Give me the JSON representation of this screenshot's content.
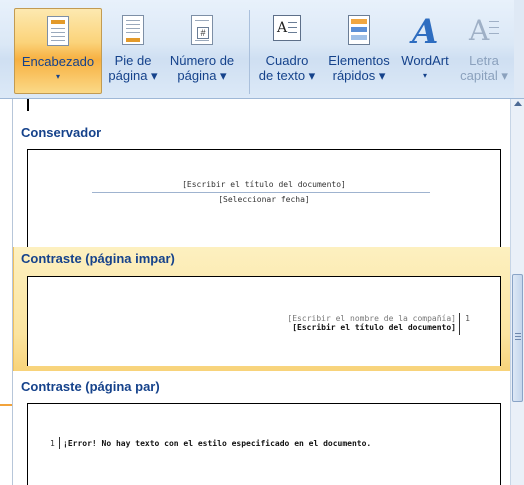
{
  "ribbon": {
    "buttons": [
      {
        "line1": "Encabezado",
        "line2": "▾"
      },
      {
        "line1": "Pie de",
        "line2": "página ▾"
      },
      {
        "line1": "Número de",
        "line2": "página ▾"
      },
      {
        "line1": "Cuadro",
        "line2": "de texto ▾"
      },
      {
        "line1": "Elementos",
        "line2": "rápidos ▾"
      },
      {
        "line1": "WordArt",
        "line2": "▾"
      },
      {
        "line1": "Letra",
        "line2": "capital ▾"
      }
    ],
    "icon_letters": {
      "textbox": "A",
      "wordart": "A",
      "dropcap": "A",
      "page_number": "#"
    }
  },
  "gallery": {
    "sections": [
      {
        "title": "Conservador",
        "preview_lines": [
          "[Escribir el título del documento]",
          "[Seleccionar fecha]"
        ]
      },
      {
        "title": "Contraste (página impar)",
        "preview_lines": [
          "[Escribir el nombre de la compañía]",
          "[Escribir el título del documento]"
        ],
        "page_number": "1"
      },
      {
        "title": "Contraste (página par)",
        "page_number": "1",
        "preview_lines": [
          "¡Error! No hay texto con el estilo especificado en el documento."
        ]
      }
    ]
  },
  "colors": {
    "accent": "#15428b",
    "highlight": "#fbd37a",
    "selection_bar": "#f2a33b"
  }
}
